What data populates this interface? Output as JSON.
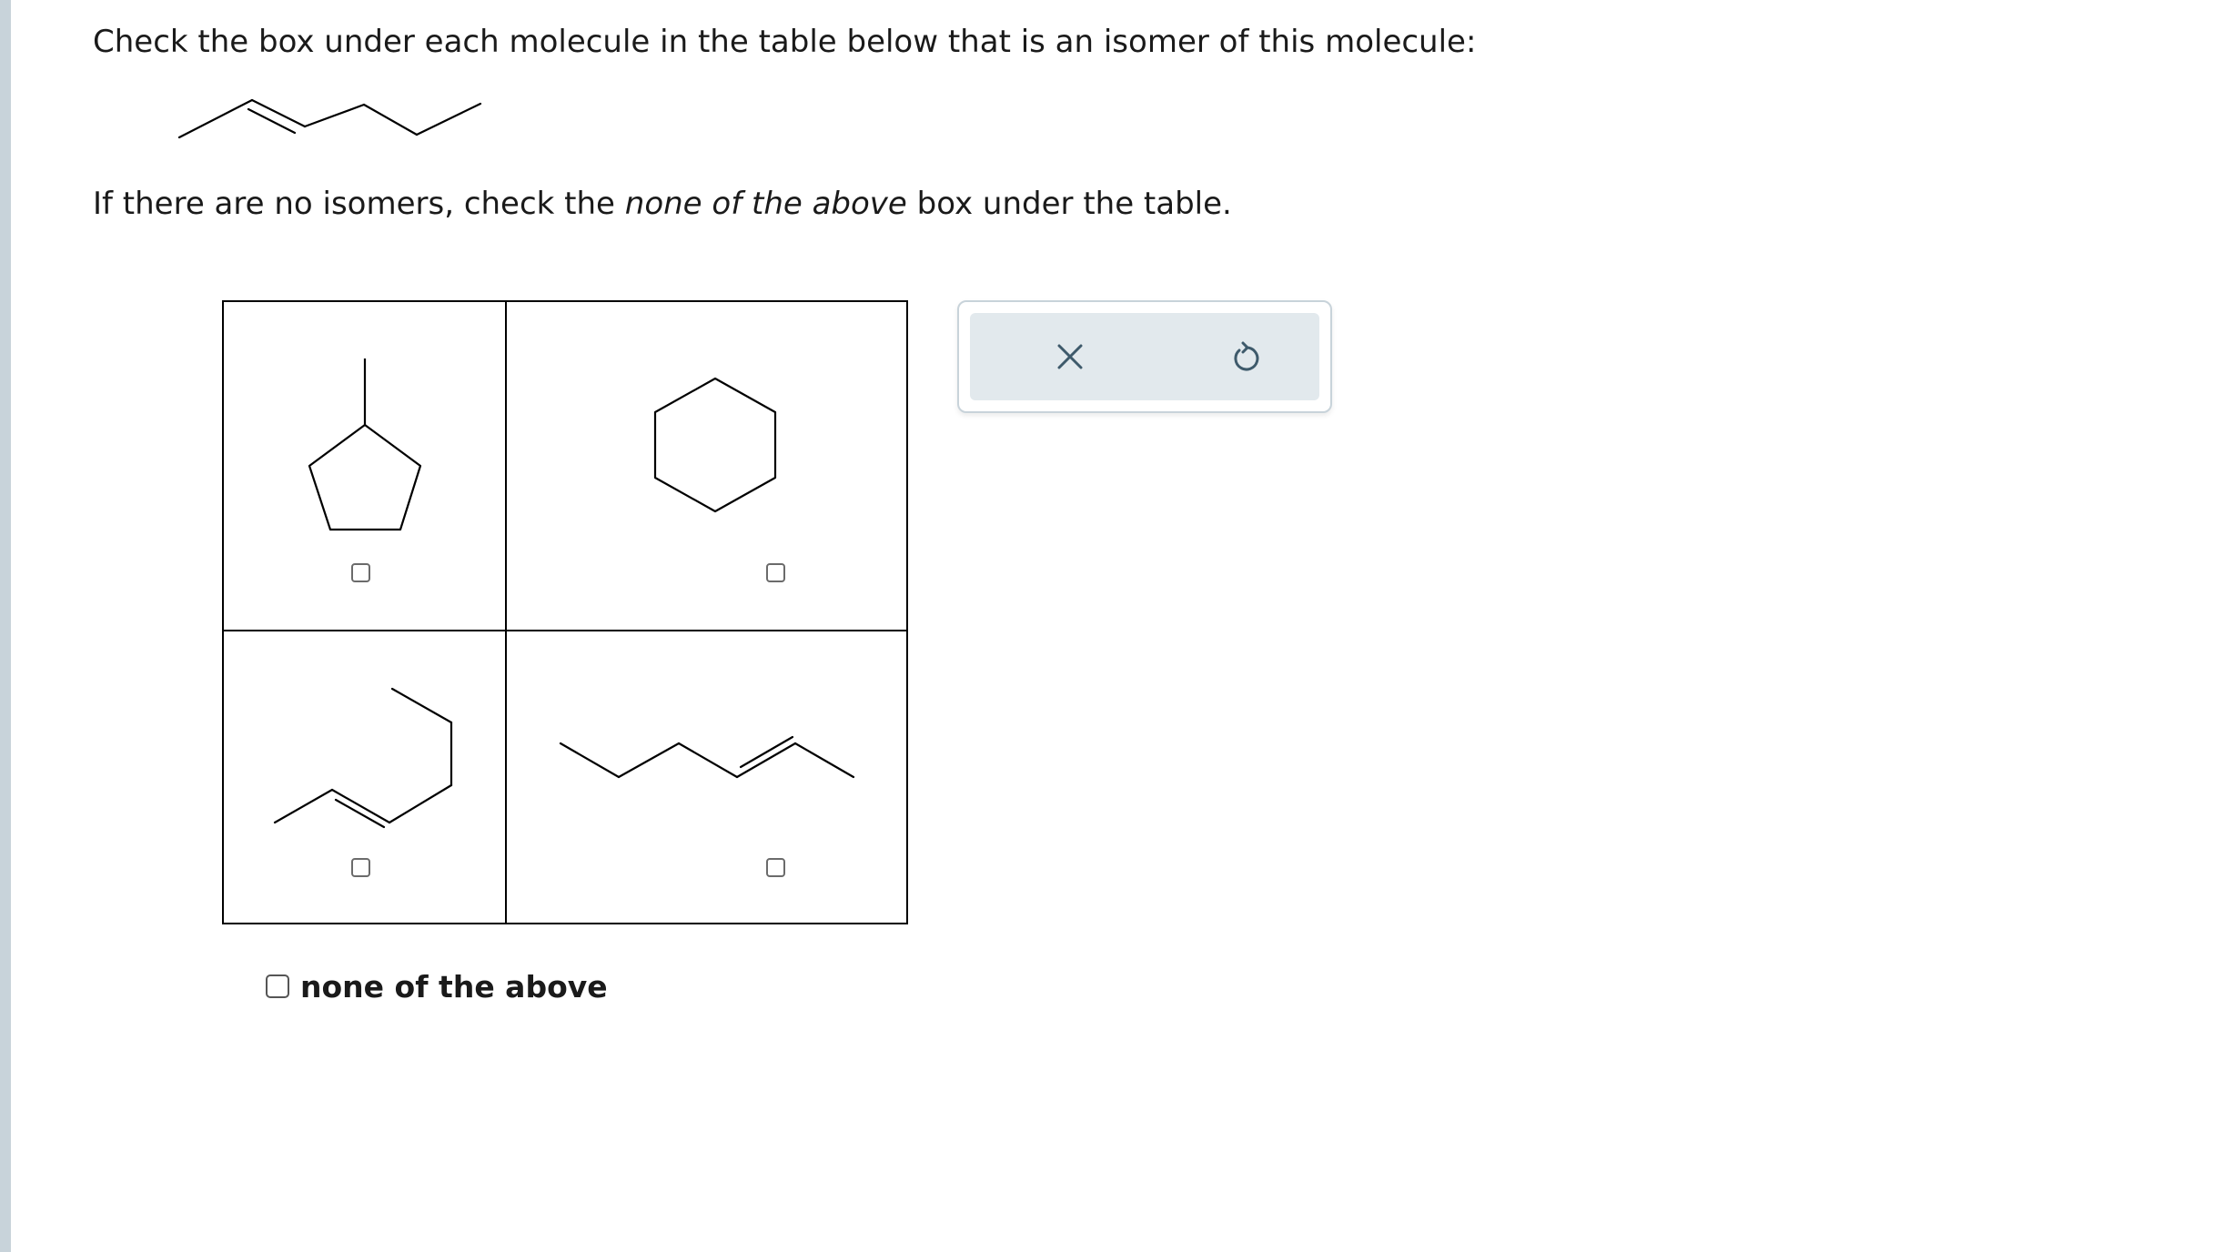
{
  "question": {
    "prompt": "Check the box under each molecule in the table below that is an isomer of this molecule:",
    "instruction_before": "If there are no isomers, check the ",
    "instruction_emphasis": "none of the above",
    "instruction_after": " box under the table."
  },
  "target_molecule": {
    "icon": "skeletal-formula-pent-2-ene"
  },
  "table": {
    "cells": [
      {
        "icon": "methylcyclopentane-structure",
        "checked": false
      },
      {
        "icon": "cyclohexane-structure",
        "checked": false
      },
      {
        "icon": "hex-2-ene-structure",
        "checked": false
      },
      {
        "icon": "hex-2-ene-zigzag-structure",
        "checked": false
      }
    ]
  },
  "none_option": {
    "label": "none of the above",
    "checked": false
  },
  "tools": {
    "clear_icon": "close-x-icon",
    "undo_icon": "undo-icon"
  },
  "colors": {
    "left_bar": "#c8d3da",
    "tool_panel_bg": "#e2e9ed",
    "tool_icon": "#3e5a6b"
  }
}
